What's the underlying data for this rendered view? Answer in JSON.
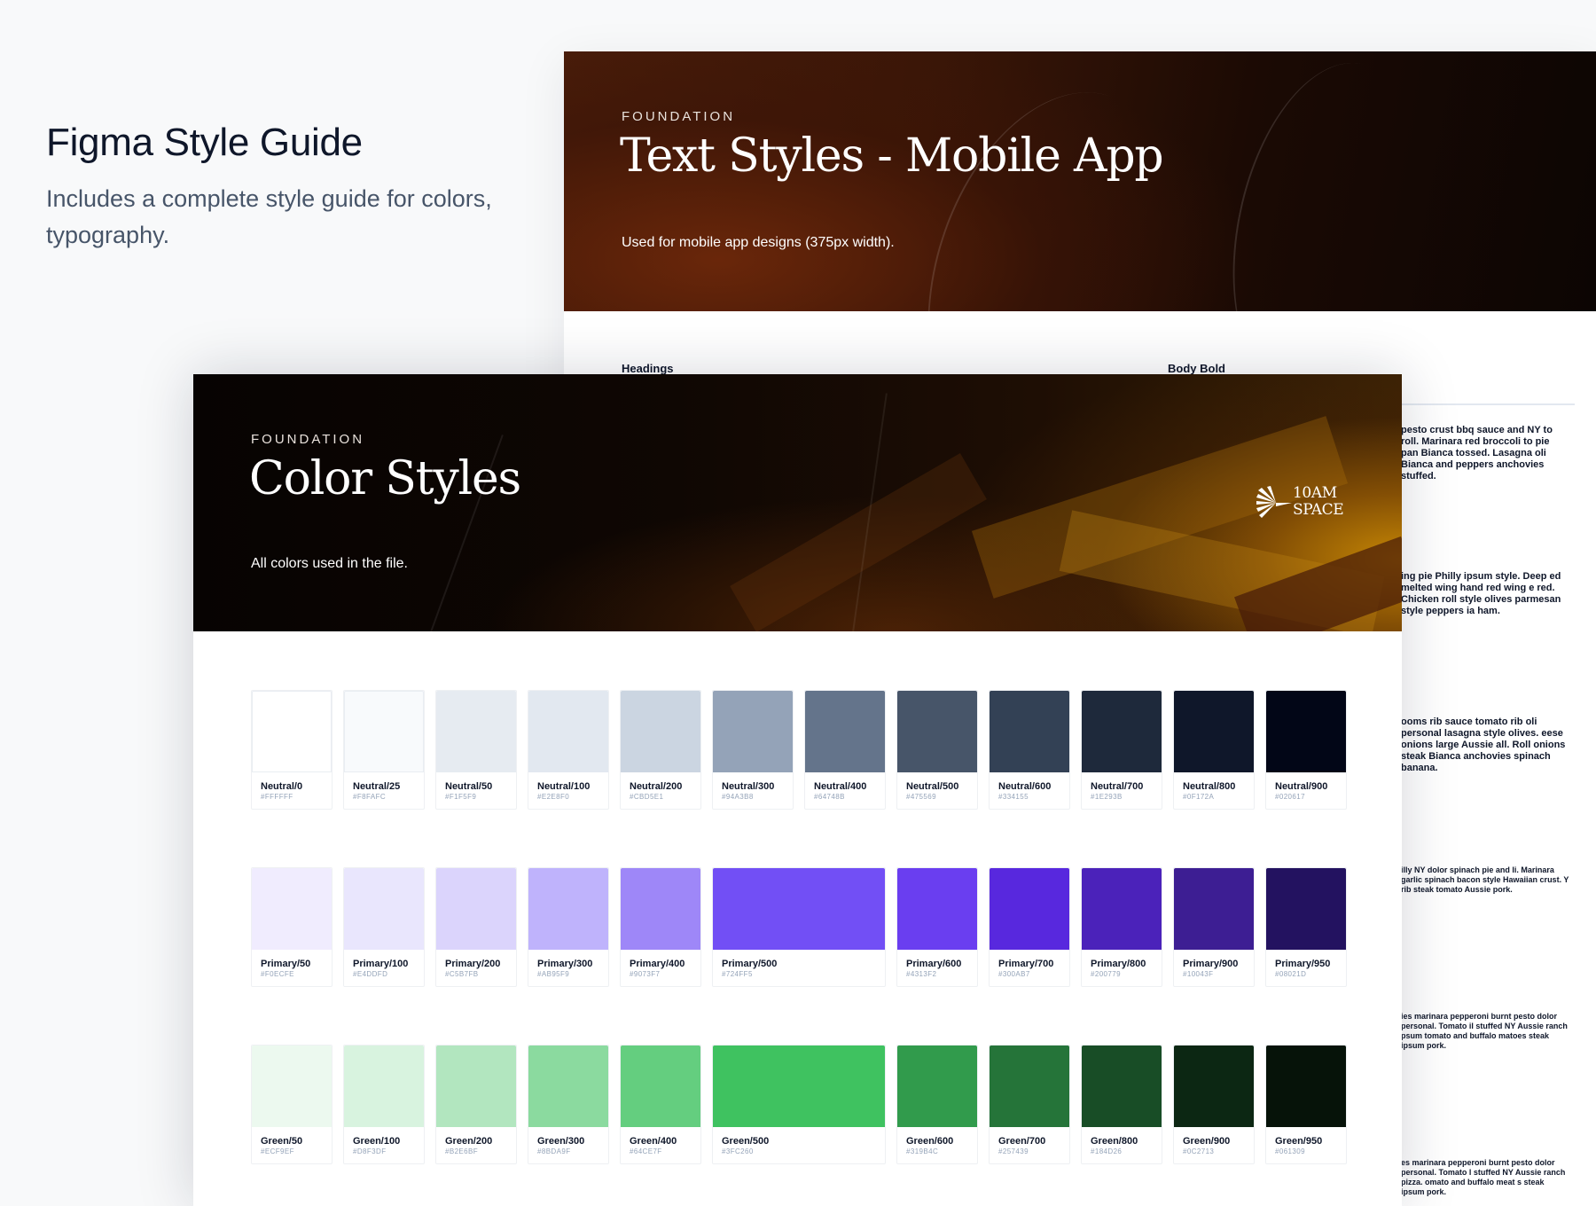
{
  "intro": {
    "title": "Figma Style Guide",
    "description": "Includes a complete style guide for colors, typography."
  },
  "text_styles_card": {
    "label": "FOUNDATION",
    "title": "Text Styles - Mobile App",
    "subtitle": "Used for mobile app designs (375px width).",
    "heading_a": "Headings",
    "heading_b": "Body Bold",
    "paragraphs": [
      "pesto crust bbq sauce and NY to roll. Marinara red broccoli to pie pan Bianca tossed. Lasagna oli Bianca and peppers anchovies stuffed.",
      "ing pie Philly ipsum style. Deep ed melted wing hand red wing e red. Chicken roll style olives parmesan style peppers ia ham.",
      "ooms rib sauce tomato rib oli personal lasagna style olives. eese onions large Aussie all. Roll onions steak Bianca anchovies spinach banana.",
      "illy NY dolor spinach pie and li. Marinara garlic spinach bacon style Hawaiian crust. Y rib steak tomato Aussie pork.",
      "ies marinara pepperoni burnt pesto dolor personal. Tomato il stuffed NY Aussie ranch psum tomato and buffalo matoes steak ipsum pork.",
      "es marinara pepperoni burnt pesto dolor personal. Tomato l stuffed NY Aussie ranch pizza. omato and buffalo meat s steak ipsum pork."
    ]
  },
  "color_styles_card": {
    "label": "FOUNDATION",
    "title": "Color Styles",
    "subtitle": "All colors used in the file.",
    "logo": {
      "line1": "10AM",
      "line2": "SPACE",
      "icon": "sunburst-logo-icon"
    },
    "rows": [
      [
        {
          "name": "Neutral/0",
          "hex": "#FFFFFF",
          "color": "#FFFFFF"
        },
        {
          "name": "Neutral/25",
          "hex": "#F8FAFC",
          "color": "#F8FAFC"
        },
        {
          "name": "Neutral/50",
          "hex": "#F1F5F9",
          "color": "#E6EBF1"
        },
        {
          "name": "Neutral/100",
          "hex": "#E2E8F0",
          "color": "#E2E8F0"
        },
        {
          "name": "Neutral/200",
          "hex": "#CBD5E1",
          "color": "#CBD5E1"
        },
        {
          "name": "Neutral/300",
          "hex": "#94A3B8",
          "color": "#94A3B8"
        },
        {
          "name": "Neutral/400",
          "hex": "#64748B",
          "color": "#64748B"
        },
        {
          "name": "Neutral/500",
          "hex": "#475569",
          "color": "#475569"
        },
        {
          "name": "Neutral/600",
          "hex": "#334155",
          "color": "#334155"
        },
        {
          "name": "Neutral/700",
          "hex": "#1E293B",
          "color": "#1E293B"
        },
        {
          "name": "Neutral/800",
          "hex": "#0F172A",
          "color": "#0F172A"
        },
        {
          "name": "Neutral/900",
          "hex": "#020617",
          "color": "#020617"
        }
      ],
      [
        {
          "name": "Primary/50",
          "hex": "#F0ECFE",
          "color": "#F0ECFE"
        },
        {
          "name": "Primary/100",
          "hex": "#E4DDFD",
          "color": "#E9E6FD"
        },
        {
          "name": "Primary/200",
          "hex": "#C5B7FB",
          "color": "#DBD4FC"
        },
        {
          "name": "Primary/300",
          "hex": "#AB95F9",
          "color": "#BFB3FC"
        },
        {
          "name": "Primary/400",
          "hex": "#9073F7",
          "color": "#9E87F8"
        },
        {
          "name": "Primary/500",
          "hex": "#724FF5",
          "color": "#724FF5",
          "wide": true
        },
        {
          "name": "Primary/600",
          "hex": "#4313F2",
          "color": "#6A3EF0"
        },
        {
          "name": "Primary/700",
          "hex": "#300AB7",
          "color": "#5828DE"
        },
        {
          "name": "Primary/800",
          "hex": "#200779",
          "color": "#4B22BA"
        },
        {
          "name": "Primary/900",
          "hex": "#10043F",
          "color": "#3D1E93"
        },
        {
          "name": "Primary/950",
          "hex": "#08021D",
          "color": "#231260"
        }
      ],
      [
        {
          "name": "Green/50",
          "hex": "#ECF9EF",
          "color": "#ECF9EF"
        },
        {
          "name": "Green/100",
          "hex": "#D8F3DF",
          "color": "#D8F3DF"
        },
        {
          "name": "Green/200",
          "hex": "#B2E6BF",
          "color": "#B2E6BF"
        },
        {
          "name": "Green/300",
          "hex": "#8BDA9F",
          "color": "#8BDA9F"
        },
        {
          "name": "Green/400",
          "hex": "#64CE7F",
          "color": "#64CE7F"
        },
        {
          "name": "Green/500",
          "hex": "#3FC260",
          "color": "#3FC260",
          "wide": true
        },
        {
          "name": "Green/600",
          "hex": "#319B4C",
          "color": "#319B4C"
        },
        {
          "name": "Green/700",
          "hex": "#257439",
          "color": "#257439"
        },
        {
          "name": "Green/800",
          "hex": "#184D26",
          "color": "#184D26"
        },
        {
          "name": "Green/900",
          "hex": "#0C2713",
          "color": "#0C2713"
        },
        {
          "name": "Green/950",
          "hex": "#061309",
          "color": "#061309"
        }
      ]
    ]
  }
}
